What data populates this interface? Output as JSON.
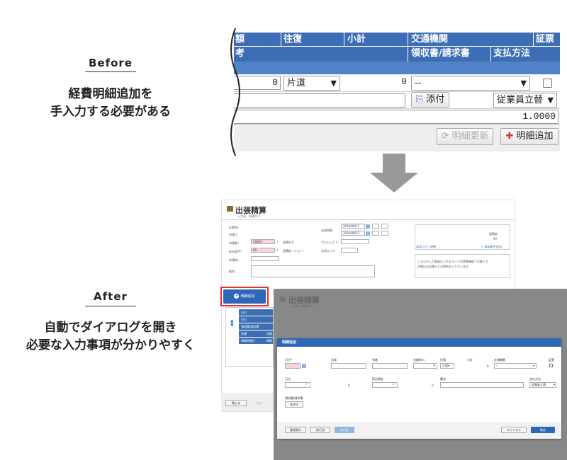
{
  "before": {
    "tag": "Before",
    "caption_lines": [
      "経費明細追加を",
      "手入力する必要がある"
    ],
    "header": {
      "col_amount_fragment": "額",
      "col_roundtrip": "往復",
      "col_subtotal": "小計",
      "col_transport": "交通機関",
      "col_receipt": "証票",
      "col_note_fragment": "考",
      "col_receipt_invoice": "領収書/請求書",
      "col_payment": "支払方法"
    },
    "row1": {
      "amount_value": "0",
      "trip_select": "片道",
      "subtotal_value": "0",
      "transport_select": "--"
    },
    "row2": {
      "attach_button": "添付",
      "payment_select": "従業員立替"
    },
    "row3": {
      "rate_value": "1.0000"
    },
    "buttons": {
      "refresh": "明細更新",
      "add": "明細追加"
    }
  },
  "after": {
    "tag": "After",
    "caption_lines": [
      "自動でダイアログを開き",
      "必要な入力事項が分かりやすく"
    ],
    "page": {
      "title": "出張精算",
      "subtitle": "入力者：稲積花子",
      "labels": {
        "request_no": "伝票No.",
        "request_date": "申請日",
        "applicant": "申請者*",
        "dept": "負担部門*",
        "apply_no": "申請No.",
        "note": "備考",
        "trip_period": "出張期間",
        "project": "プロジェクト",
        "trip_area": "出張エリア"
      },
      "values": {
        "date_from": "2020/08/11",
        "date_to": "2020/08/11",
        "applicant_code": "10004",
        "applicant_name": "稲積花子",
        "dept_code": "99",
        "dept_name": "稲積部（テスト）"
      },
      "right_box": {
        "approver": "稲積部",
        "approver_num": "99",
        "flow_link": "承認フロー詳細",
        "attach_link": "+ 承認者を追加",
        "info_text_1": "こちらの入力画面はカスタマイズ可標準機能で可能です",
        "info_text_2": "詳細は右記載のとお問合せくださいませ"
      },
      "add_button": "明細追加",
      "side_rows": [
        "日付",
        "日付",
        "領収書/請求書",
        "金額",
        "明細明細行"
      ],
      "side_rows_right": [
        "",
        "",
        "",
        "詳細",
        "明細"
      ],
      "close_button": "閉じる",
      "faded_button": "保存"
    },
    "overlay_title": "出張精算",
    "overlay_subtitle": "入力者：稲積花子",
    "modal": {
      "title": "明細追加",
      "labels": {
        "date": "日付*",
        "departure": "出発",
        "arrival": "到着",
        "amount_km": "金額/Km",
        "roundtrip": "往復",
        "subtotal": "小計",
        "transport": "交通機関",
        "receipt": "証票",
        "daily": "日当",
        "lodging": "宿泊規定",
        "note": "備考",
        "payment": "支払方法",
        "receipt_invoice": "領収書/請求書"
      },
      "values": {
        "amount": "0",
        "trip_select": "片道",
        "subtotal": "0",
        "transport_select": "--",
        "daily_value": "0",
        "lodging_value": "0",
        "payment_select": "従業員立替"
      },
      "buttons": {
        "attach": "添付",
        "route": "乗換案内",
        "prev": "前行追",
        "next": "次行追",
        "cancel": "キャンセル",
        "ok": "確定"
      }
    }
  },
  "colors": {
    "header_blue": "#3d6eb5",
    "accent_red": "#e0302a",
    "arrow_gray": "#999999"
  }
}
